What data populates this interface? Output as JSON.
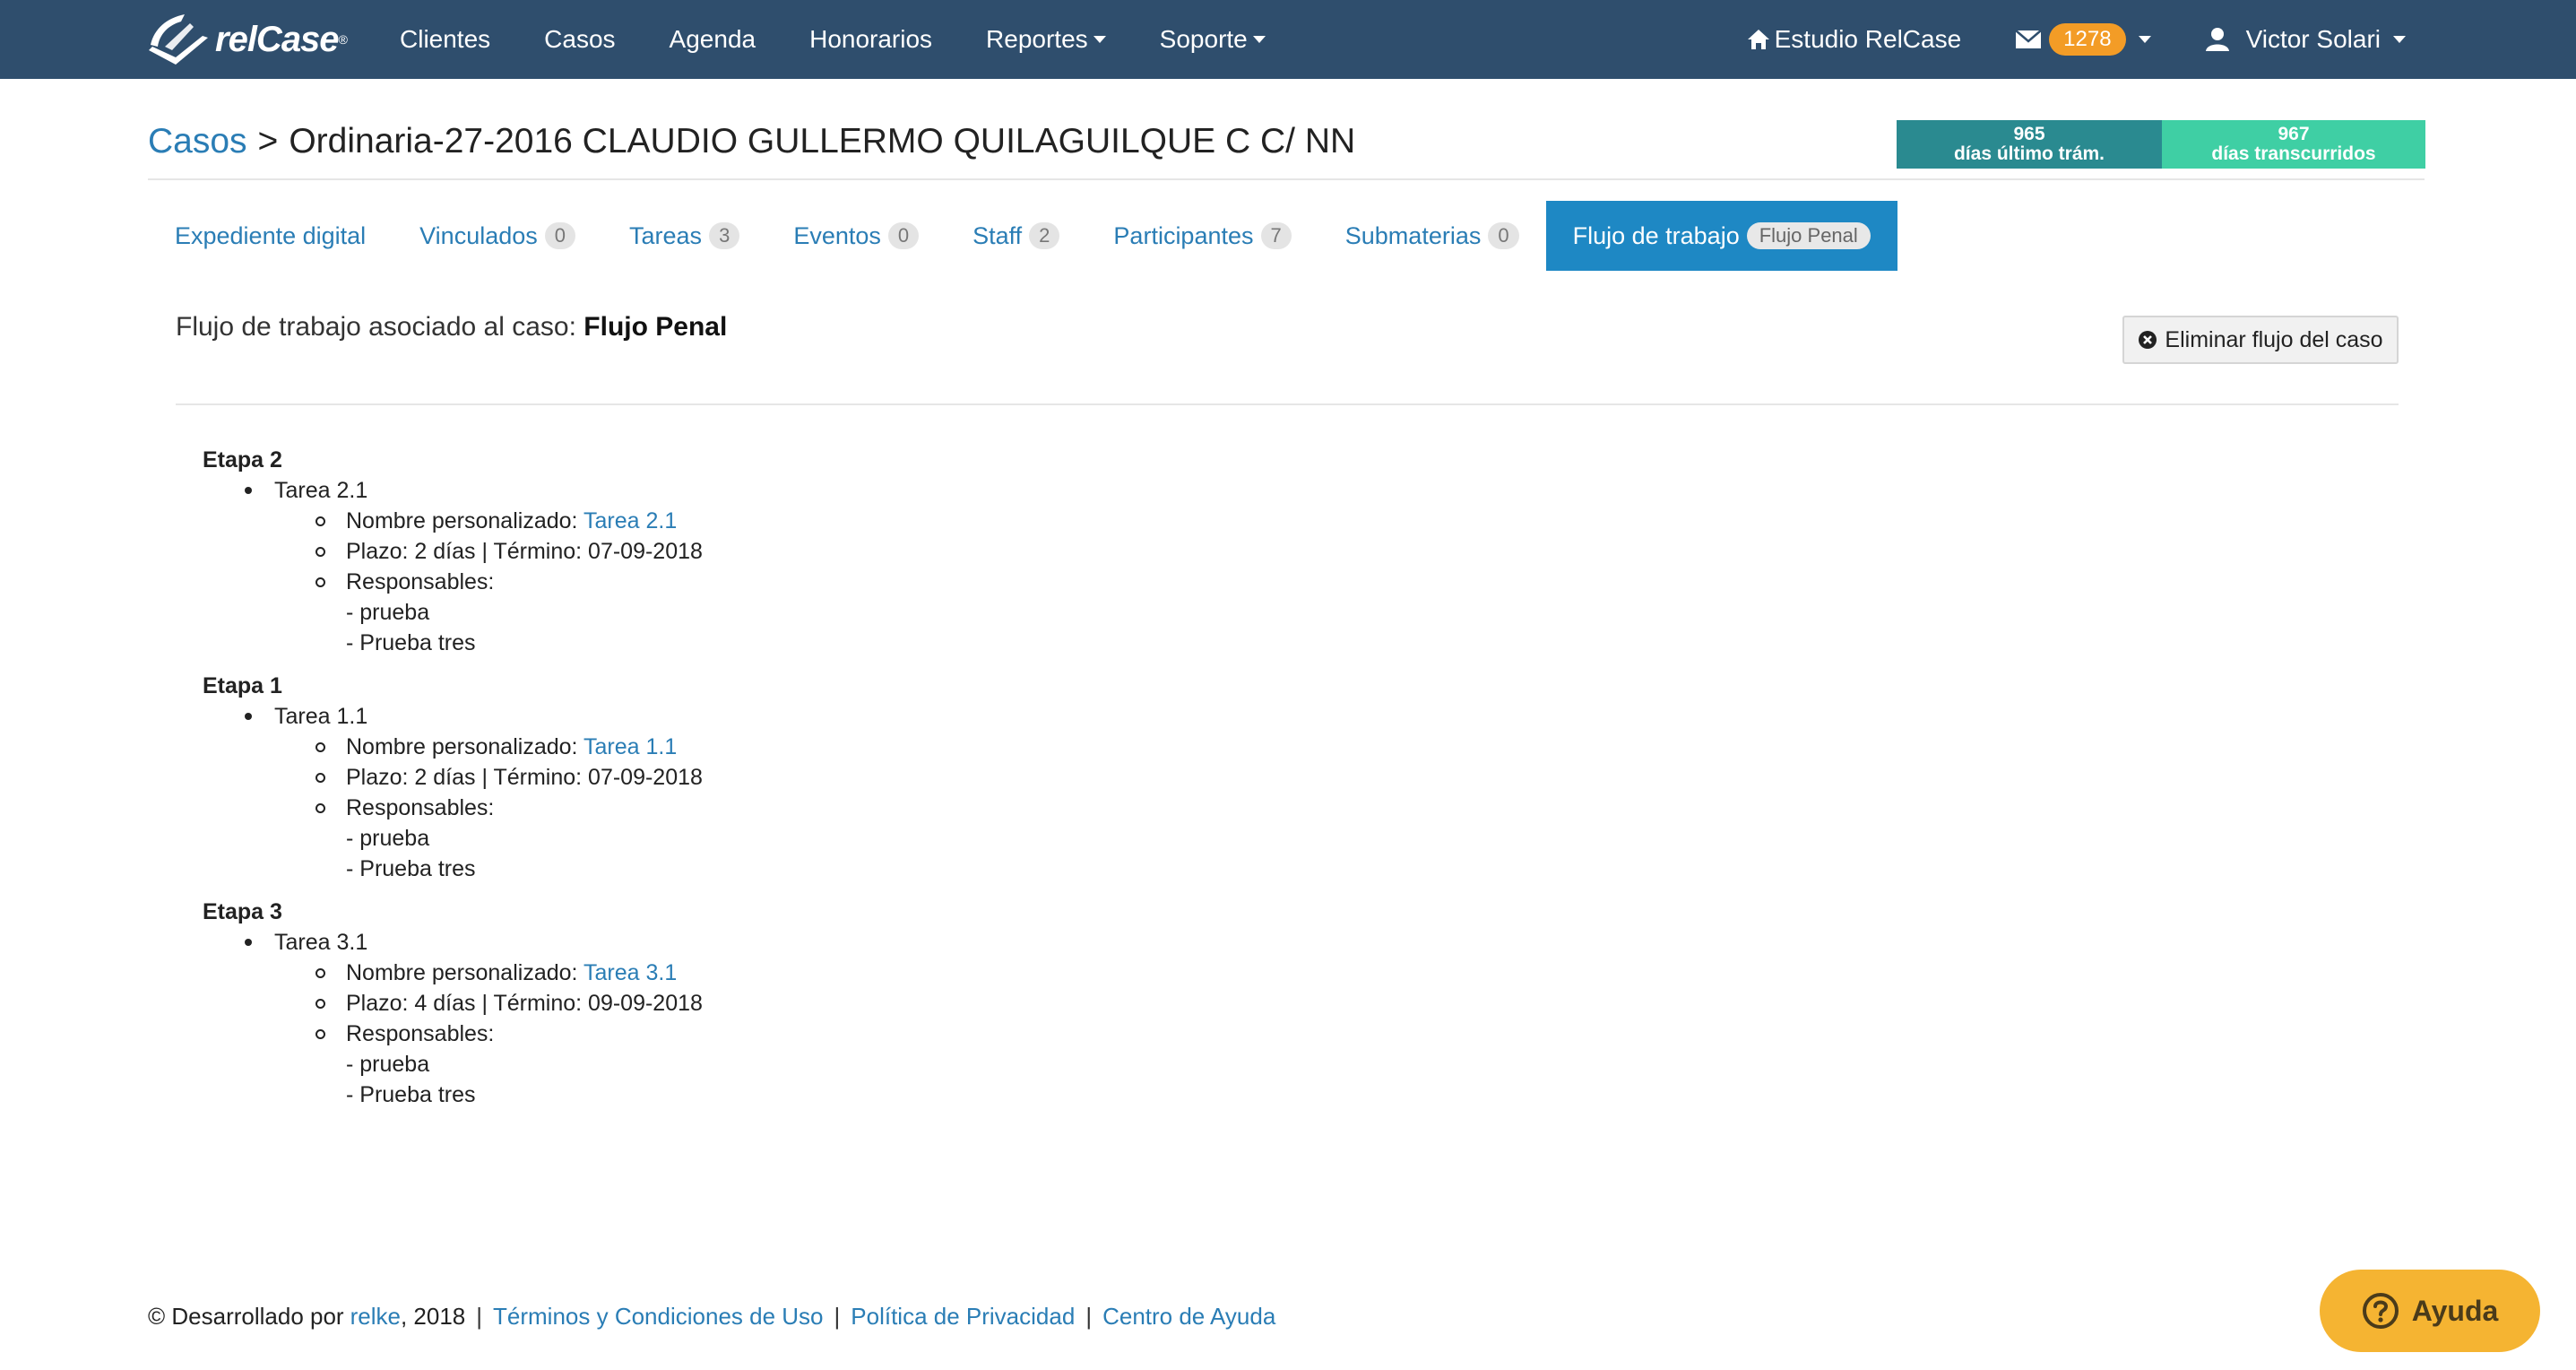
{
  "navbar": {
    "brand": "relCase",
    "brand_reg": "®",
    "items": [
      {
        "label": "Clientes",
        "dropdown": false
      },
      {
        "label": "Casos",
        "dropdown": false
      },
      {
        "label": "Agenda",
        "dropdown": false
      },
      {
        "label": "Honorarios",
        "dropdown": false
      },
      {
        "label": "Reportes",
        "dropdown": true
      },
      {
        "label": "Soporte",
        "dropdown": true
      }
    ],
    "studio": "Estudio RelCase",
    "mail_count": "1278",
    "user": "Victor Solari"
  },
  "breadcrumb": {
    "root": "Casos",
    "separator": ">",
    "case_title": "Ordinaria-27-2016 CLAUDIO GULLERMO QUILAGUILQUE C C/ NN"
  },
  "stats": {
    "last_proc_value": "965",
    "last_proc_label": "días último trám.",
    "elapsed_value": "967",
    "elapsed_label": "días transcurridos"
  },
  "tabs": [
    {
      "label": "Expediente digital",
      "count": ""
    },
    {
      "label": "Vinculados",
      "count": "0"
    },
    {
      "label": "Tareas",
      "count": "3"
    },
    {
      "label": "Eventos",
      "count": "0"
    },
    {
      "label": "Staff",
      "count": "2"
    },
    {
      "label": "Participantes",
      "count": "7"
    },
    {
      "label": "Submaterias",
      "count": "0"
    },
    {
      "label": "Flujo de trabajo",
      "count": "Flujo Penal",
      "active": true
    }
  ],
  "workflow": {
    "heading_prefix": "Flujo de trabajo asociado al caso:",
    "heading_name": "Flujo Penal",
    "delete_label": "Eliminar flujo del caso",
    "stages": [
      {
        "title": "Etapa 2",
        "task": "Tarea 2.1",
        "custom_name_label": "Nombre personalizado:",
        "custom_name": "Tarea 2.1",
        "deadline": "Plazo: 2 días | Término: 07-09-2018",
        "responsables_label": "Responsables:",
        "responsables": [
          "- prueba",
          "- Prueba tres"
        ]
      },
      {
        "title": "Etapa 1",
        "task": "Tarea 1.1",
        "custom_name_label": "Nombre personalizado:",
        "custom_name": "Tarea 1.1",
        "deadline": "Plazo: 2 días | Término: 07-09-2018",
        "responsables_label": "Responsables:",
        "responsables": [
          "- prueba",
          "- Prueba tres"
        ]
      },
      {
        "title": "Etapa 3",
        "task": "Tarea 3.1",
        "custom_name_label": "Nombre personalizado:",
        "custom_name": "Tarea 3.1",
        "deadline": "Plazo: 4 días | Término: 09-09-2018",
        "responsables_label": "Responsables:",
        "responsables": [
          "- prueba",
          "- Prueba tres"
        ]
      }
    ]
  },
  "footer": {
    "copyright_prefix": "© Desarrollado por",
    "company": "relke",
    "year": ", 2018",
    "links": [
      "Términos y Condiciones de Uso",
      "Política de Privacidad",
      "Centro de Ayuda"
    ]
  },
  "help": {
    "label": "Ayuda",
    "icon": "question-circle-icon"
  },
  "colors": {
    "navbar": "#2f4e6d",
    "link": "#2a7db5",
    "active_tab": "#1e88c4",
    "badge": "#f39c26",
    "stat_1": "#2a8a90",
    "stat_2": "#3fcfa4",
    "help": "#f5b432"
  }
}
